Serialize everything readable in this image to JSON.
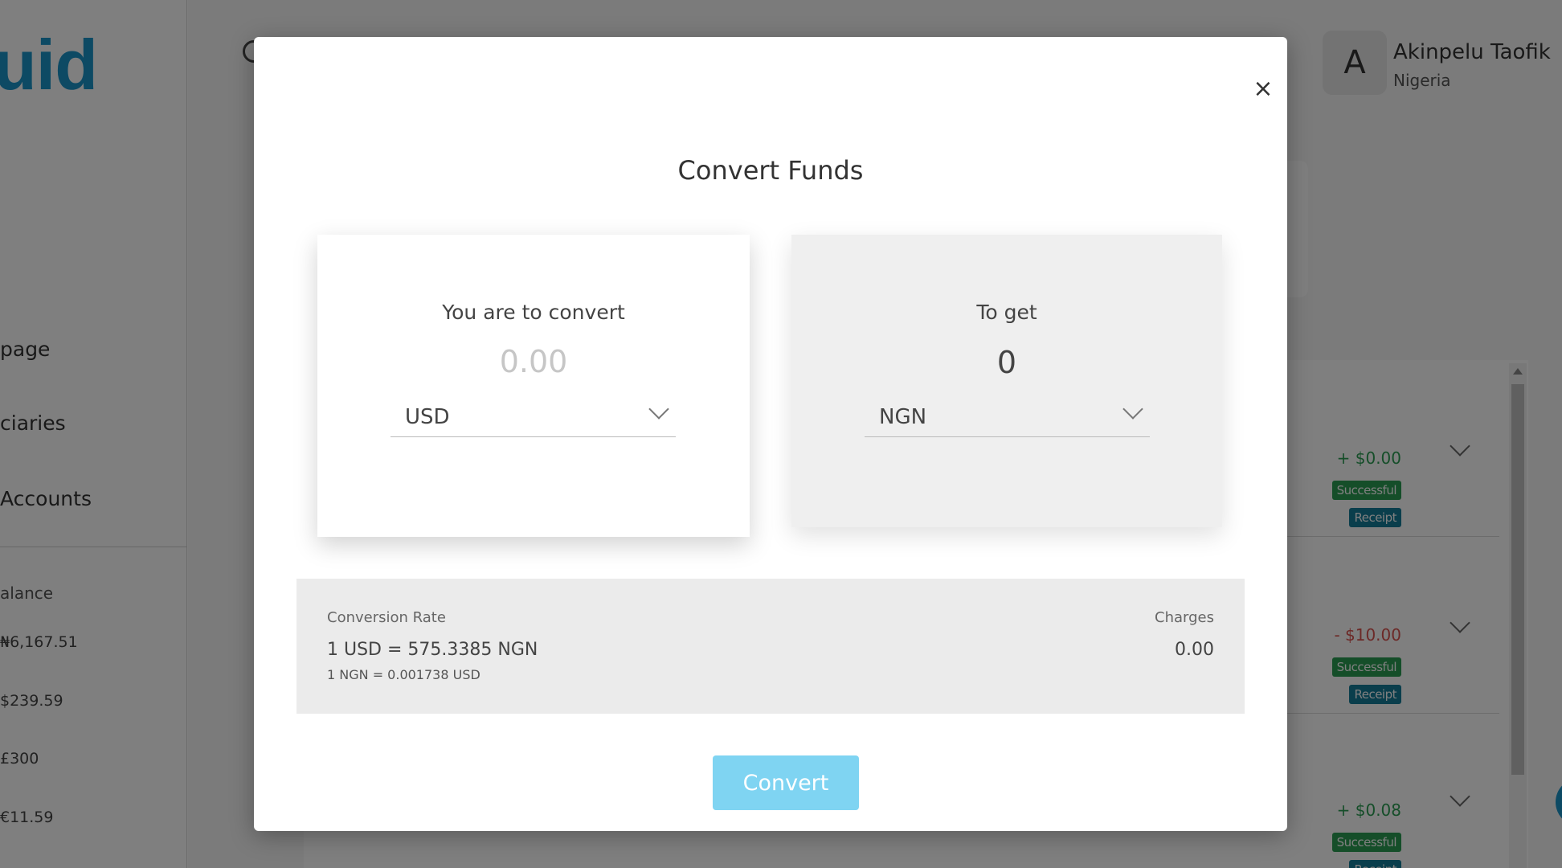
{
  "app": {
    "logo_text": "uid",
    "nav": [
      "page",
      "ciaries",
      "Accounts"
    ],
    "balance_label": "alance",
    "balances": [
      "₦6,167.51",
      "$239.59",
      "£300",
      "€11.59"
    ]
  },
  "user": {
    "avatar_initial": "A",
    "name": "Akinpelu Taofik",
    "country": "Nigeria"
  },
  "transactions": [
    {
      "amount": "+ $0.00",
      "type": "credit",
      "status": "Successful",
      "action": "Receipt"
    },
    {
      "amount": "- $10.00",
      "type": "debit",
      "status": "Successful",
      "action": "Receipt"
    },
    {
      "amount": "+ $0.08",
      "type": "credit",
      "status": "Successful",
      "action": "Receipt"
    }
  ],
  "modal": {
    "close_symbol": "×",
    "title": "Convert Funds",
    "from": {
      "label": "You are to convert",
      "amount_placeholder": "0.00",
      "currency": "USD"
    },
    "to": {
      "label": "To get",
      "amount": "0",
      "currency": "NGN"
    },
    "rate": {
      "label": "Conversion Rate",
      "main": "1 USD = 575.3385 NGN",
      "inverse": "1 NGN = 0.001738 USD"
    },
    "charges": {
      "label": "Charges",
      "value": "0.00"
    },
    "convert_label": "Convert"
  },
  "colors": {
    "brand": "#1b95c9",
    "convert_button": "#7fd4f2",
    "success": "#2a9d52",
    "receipt": "#157c98",
    "debit": "#d9534f"
  }
}
